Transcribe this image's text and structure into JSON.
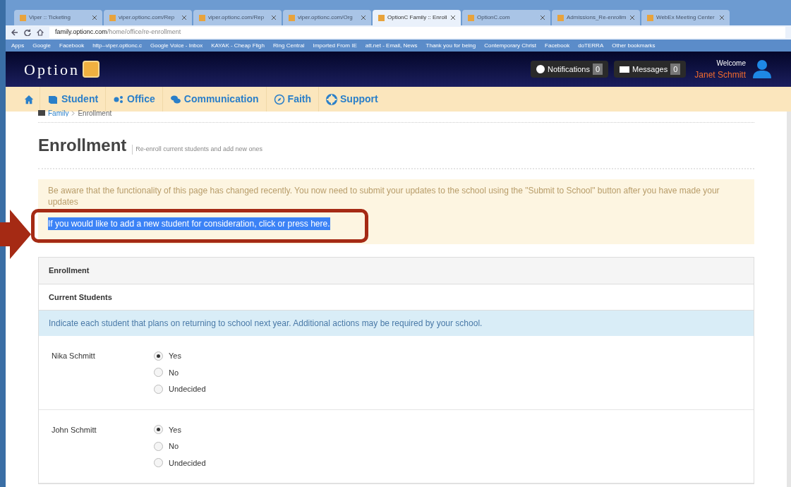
{
  "browser": {
    "tabs": [
      {
        "title": "Viper :: Ticketing",
        "selected": false
      },
      {
        "title": "viper.optionc.com/Rep",
        "selected": false
      },
      {
        "title": "viper.optionc.com/Rep",
        "selected": false
      },
      {
        "title": "viper.optionc.com/Org",
        "selected": false
      },
      {
        "title": "OptionC Family :: Enroll",
        "selected": true
      },
      {
        "title": "OptionC.com",
        "selected": false
      },
      {
        "title": "Admissions_Re-enrollm",
        "selected": false
      },
      {
        "title": "WebEx Meeting Center",
        "selected": false
      }
    ],
    "address": {
      "host": "family.optionc.com",
      "path": "/home/office/re-enrollment"
    },
    "bookmarks": [
      "Apps",
      "Google",
      "Facebook",
      "http--viper.optionc.c",
      "Google Voice - Inbox",
      "KAYAK - Cheap Fligh",
      "Ring Central",
      "Imported From IE",
      "att.net - Email, News",
      "Thank you for being",
      "Contemporary Christ",
      "Facebook",
      "doTERRA",
      "Other bookmarks"
    ]
  },
  "header": {
    "logo_text": "Option",
    "notifications": {
      "label": "Notifications",
      "count": "0"
    },
    "messages": {
      "label": "Messages",
      "count": "0"
    },
    "welcome": "Welcome",
    "user_name": "Janet Schmitt"
  },
  "nav": {
    "items": [
      {
        "label": "Student"
      },
      {
        "label": "Office"
      },
      {
        "label": "Communication"
      },
      {
        "label": "Faith"
      },
      {
        "label": "Support"
      }
    ]
  },
  "breadcrumb": [
    "Family",
    "Enrollment"
  ],
  "page_title": "Enrollment",
  "page_subtitle": "Re-enroll current students and add new ones",
  "notice": {
    "text": "Be aware that the functionality of this page has changed recently. You now need to submit your updates to the school using the \"Submit to School\" button after you have made your updates",
    "link": "If you would like to add a new student for consideration, click or press here.",
    "link_selected": true
  },
  "panel": {
    "title": "Enrollment",
    "section": "Current Students",
    "info": "Indicate each student that plans on returning to school next year. Additional actions may be required by your school.",
    "students": [
      {
        "name": "Nika Schmitt",
        "options": [
          {
            "label": "Yes",
            "selected": true
          },
          {
            "label": "No",
            "selected": false
          },
          {
            "label": "Undecided",
            "selected": false
          }
        ]
      },
      {
        "name": "John Schmitt",
        "options": [
          {
            "label": "Yes",
            "selected": true
          },
          {
            "label": "No",
            "selected": false
          },
          {
            "label": "Undecided",
            "selected": false
          }
        ]
      }
    ]
  }
}
